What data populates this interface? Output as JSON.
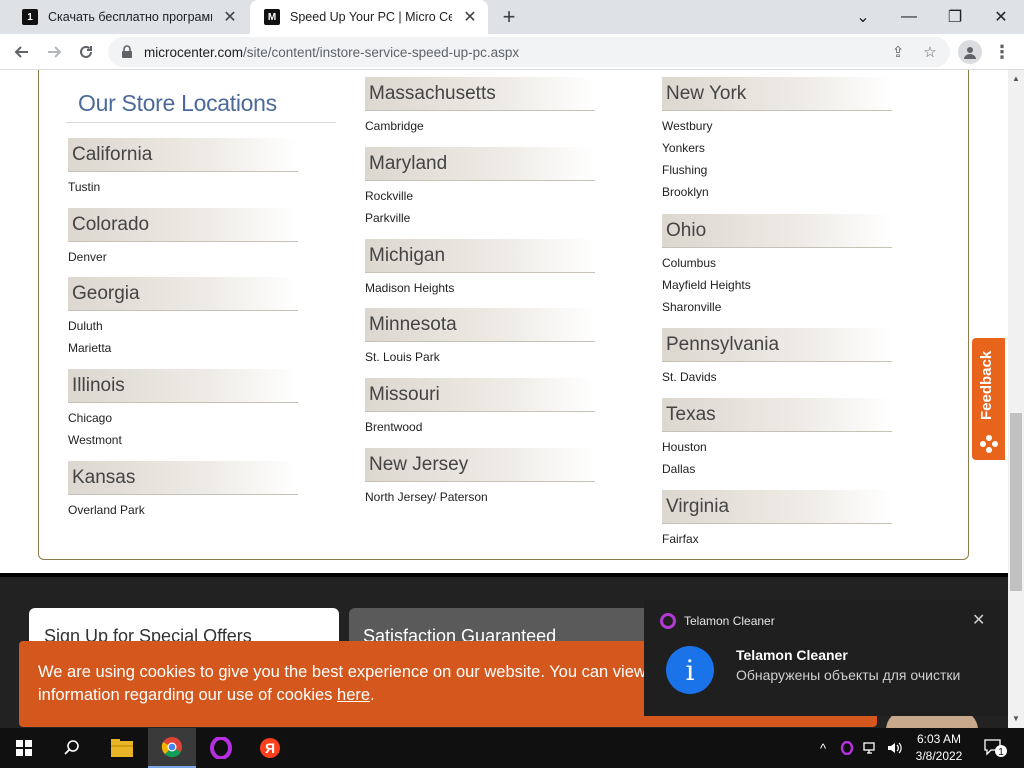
{
  "browser": {
    "tabs": [
      {
        "title": "Скачать бесплатно программы",
        "favicon": "1",
        "active": false
      },
      {
        "title": "Speed Up Your PC | Micro Center",
        "favicon": "M",
        "active": true
      }
    ],
    "url_domain": "microcenter.com",
    "url_path": "/site/content/instore-service-speed-up-pc.aspx",
    "icons": {
      "back": "arrow-left-icon",
      "forward": "arrow-right-icon",
      "reload": "reload-icon",
      "lock": "lock-icon",
      "share": "share-icon",
      "bookmark": "star-icon",
      "profile": "profile-icon",
      "menu": "kebab-menu-icon"
    }
  },
  "page": {
    "heading": "Our Store Locations",
    "columns": [
      [
        {
          "state": "California",
          "cities": [
            "Tustin"
          ]
        },
        {
          "state": "Colorado",
          "cities": [
            "Denver"
          ]
        },
        {
          "state": "Georgia",
          "cities": [
            "Duluth",
            "Marietta"
          ]
        },
        {
          "state": "Illinois",
          "cities": [
            "Chicago",
            "Westmont"
          ]
        },
        {
          "state": "Kansas",
          "cities": [
            "Overland Park"
          ]
        }
      ],
      [
        {
          "state": "Massachusetts",
          "cities": [
            "Cambridge"
          ]
        },
        {
          "state": "Maryland",
          "cities": [
            "Rockville",
            "Parkville"
          ]
        },
        {
          "state": "Michigan",
          "cities": [
            "Madison Heights"
          ]
        },
        {
          "state": "Minnesota",
          "cities": [
            "St. Louis Park"
          ]
        },
        {
          "state": "Missouri",
          "cities": [
            "Brentwood"
          ]
        },
        {
          "state": "New Jersey",
          "cities": [
            "North Jersey/ Paterson"
          ]
        }
      ],
      [
        {
          "state": "New York",
          "cities": [
            "Westbury",
            "Yonkers",
            "Flushing",
            "Brooklyn"
          ]
        },
        {
          "state": "Ohio",
          "cities": [
            "Columbus",
            "Mayfield Heights",
            "Sharonville"
          ]
        },
        {
          "state": "Pennsylvania",
          "cities": [
            "St. Davids"
          ]
        },
        {
          "state": "Texas",
          "cities": [
            "Houston",
            "Dallas"
          ]
        },
        {
          "state": "Virginia",
          "cities": [
            "Fairfax"
          ]
        }
      ]
    ],
    "feedback_label": "Feedback",
    "signup_label": "Sign Up for Special Offers",
    "satisfaction_label": "Satisfaction Guaranteed",
    "cookie_text": "We are using cookies to give you the best experience on our website. You can view our",
    "cookie_text2": "information regarding our use of cookies",
    "cookie_link": "here",
    "cookie_end": ".",
    "colors": {
      "heading": "#4b6a9b",
      "cookie_bg": "#d4581e",
      "feedback_bg": "#e8641d",
      "box_border": "#8c7b4c"
    }
  },
  "notification": {
    "app": "Telamon Cleaner",
    "title": "Telamon Cleaner",
    "message": "Обнаружены объекты для очистки",
    "icon": "info-icon"
  },
  "taskbar": {
    "time": "6:03 AM",
    "date": "3/8/2022",
    "notification_count": "1",
    "apps": [
      "start-icon",
      "search-icon",
      "file-explorer-icon",
      "chrome-icon",
      "opera-icon",
      "yandex-icon"
    ],
    "tray": [
      "chevron-up-icon",
      "opera-tray-icon",
      "network-icon",
      "volume-icon"
    ]
  }
}
